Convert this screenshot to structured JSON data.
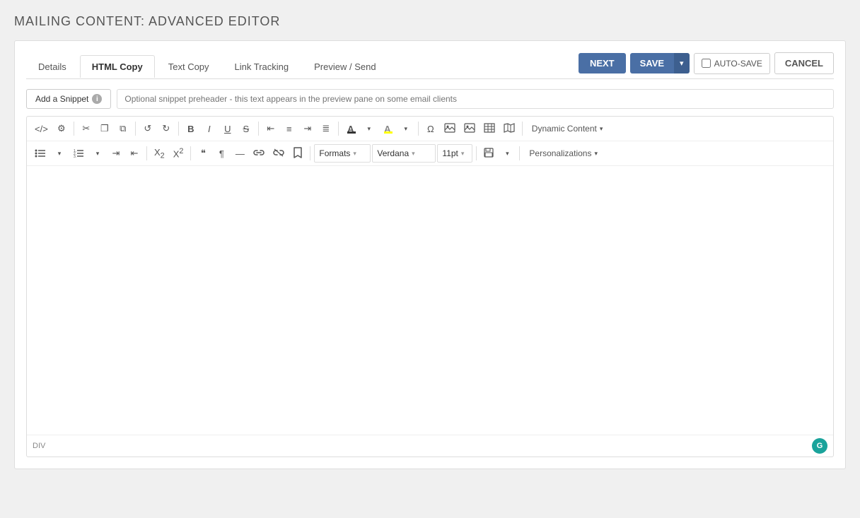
{
  "page": {
    "title": "MAILING CONTENT: ADVANCED EDITOR"
  },
  "tabs": [
    {
      "id": "details",
      "label": "Details",
      "active": false
    },
    {
      "id": "html-copy",
      "label": "HTML Copy",
      "active": true
    },
    {
      "id": "text-copy",
      "label": "Text Copy",
      "active": false
    },
    {
      "id": "link-tracking",
      "label": "Link Tracking",
      "active": false
    },
    {
      "id": "preview-send",
      "label": "Preview / Send",
      "active": false
    }
  ],
  "toolbar_right": {
    "next_label": "NEXT",
    "save_label": "SAVE",
    "autosave_label": "AUTO-SAVE",
    "cancel_label": "CANCEL"
  },
  "snippet": {
    "button_label": "Add a Snippet",
    "placeholder": "Optional snippet preheader - this text appears in the preview pane on some email clients"
  },
  "editor": {
    "toolbar_row1": {
      "source_icon": "</>",
      "settings_icon": "⚙",
      "cut_icon": "✂",
      "copy_icon": "⧉",
      "paste_icon": "📋",
      "undo_icon": "↺",
      "redo_icon": "↻",
      "bold_label": "B",
      "italic_label": "I",
      "underline_label": "U",
      "strikethrough_label": "S",
      "align_left": "≡",
      "align_center": "≡",
      "align_right": "≡",
      "align_justify": "≡",
      "font_color_label": "A",
      "highlight_label": "A",
      "omega_label": "Ω",
      "image_inline": "🖼",
      "image_block": "🖼",
      "table_icon": "⊞",
      "map_icon": "🗺",
      "dynamic_content_label": "Dynamic Content"
    },
    "toolbar_row2": {
      "ul_label": "≡",
      "ol_label": "≡",
      "indent_label": "⇥",
      "outdent_label": "⇤",
      "sub_label": "X₂",
      "sup_label": "X²",
      "blockquote_label": "❝",
      "para_label": "¶",
      "hr_label": "—",
      "link_label": "🔗",
      "unlink_label": "⛓",
      "bookmark_label": "🔖",
      "formats_label": "Formats",
      "font_label": "Verdana",
      "size_label": "11pt",
      "save_icon": "💾",
      "personalizations_label": "Personalizations"
    },
    "statusbar": {
      "element_label": "DIV"
    }
  },
  "colors": {
    "primary_blue": "#4a6fa5",
    "primary_blue_dark": "#3d5f8f",
    "grammarly_teal": "#1aa39b"
  }
}
